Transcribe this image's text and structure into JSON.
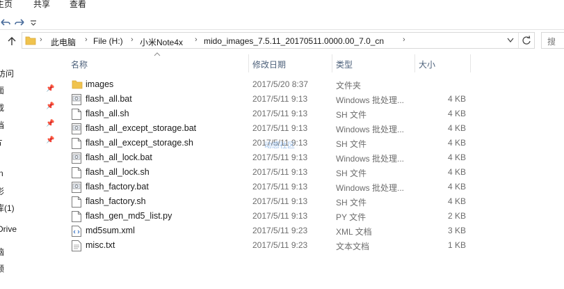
{
  "ribbon": {
    "tabs": [
      {
        "label": "主页"
      },
      {
        "label": "共享"
      },
      {
        "label": "查看"
      }
    ]
  },
  "quick_access_toolbar": {
    "icons": [
      "undo-icon",
      "redo-icon",
      "customize-dropdown-icon"
    ]
  },
  "navigation": {
    "back_icon": "arrow-left-icon",
    "forward_icon": "arrow-right-icon",
    "up_icon": "arrow-up-icon",
    "refresh_icon": "refresh-icon"
  },
  "address_bar": {
    "crumbs": [
      {
        "label": "此电脑"
      },
      {
        "label": "File (H:)"
      },
      {
        "label": "小米Note4x"
      },
      {
        "label": "mido_images_7.5.11_20170511.0000.00_7.0_cn"
      }
    ]
  },
  "columns": {
    "name": "名称",
    "date": "修改日期",
    "type": "类型",
    "size": "大小"
  },
  "files": [
    {
      "name": "images",
      "date": "2017/5/20 8:37",
      "type": "文件夹",
      "size": "",
      "icon": "folder"
    },
    {
      "name": "flash_all.bat",
      "date": "2017/5/11 9:13",
      "type": "Windows 批处理...",
      "size": "4 KB",
      "icon": "bat"
    },
    {
      "name": "flash_all.sh",
      "date": "2017/5/11 9:13",
      "type": "SH 文件",
      "size": "4 KB",
      "icon": "doc"
    },
    {
      "name": "flash_all_except_storage.bat",
      "date": "2017/5/11 9:13",
      "type": "Windows 批处理...",
      "size": "4 KB",
      "icon": "bat"
    },
    {
      "name": "flash_all_except_storage.sh",
      "date": "2017/5/11 9:13",
      "type": "SH 文件",
      "size": "4 KB",
      "icon": "doc"
    },
    {
      "name": "flash_all_lock.bat",
      "date": "2017/5/11 9:13",
      "type": "Windows 批处理...",
      "size": "4 KB",
      "icon": "bat"
    },
    {
      "name": "flash_all_lock.sh",
      "date": "2017/5/11 9:13",
      "type": "SH 文件",
      "size": "4 KB",
      "icon": "doc"
    },
    {
      "name": "flash_factory.bat",
      "date": "2017/5/11 9:13",
      "type": "Windows 批处理...",
      "size": "4 KB",
      "icon": "bat"
    },
    {
      "name": "flash_factory.sh",
      "date": "2017/5/11 9:13",
      "type": "SH 文件",
      "size": "4 KB",
      "icon": "doc"
    },
    {
      "name": "flash_gen_md5_list.py",
      "date": "2017/5/11 9:13",
      "type": "PY 文件",
      "size": "2 KB",
      "icon": "doc"
    },
    {
      "name": "md5sum.xml",
      "date": "2017/5/11 9:23",
      "type": "XML 文档",
      "size": "3 KB",
      "icon": "xml"
    },
    {
      "name": "misc.txt",
      "date": "2017/5/11 9:23",
      "type": "文本文档",
      "size": "1 KB",
      "icon": "txt"
    }
  ],
  "watermark": "动感社区",
  "sidebar": {
    "items": [
      {
        "label": "访问"
      },
      {
        "label": "面"
      },
      {
        "label": "载"
      },
      {
        "label": "档"
      },
      {
        "label": "片"
      },
      {
        "label": "n"
      },
      {
        "label": "影"
      },
      {
        "label": "库(1)"
      },
      {
        "label": "Drive"
      },
      {
        "label": "脑"
      },
      {
        "label": "频"
      }
    ]
  }
}
